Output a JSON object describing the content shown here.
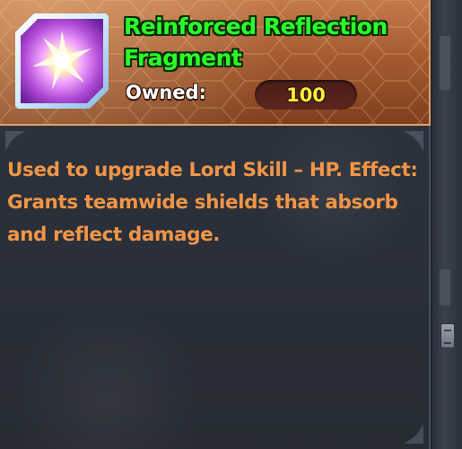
{
  "item": {
    "name": "Reinforced Reflection Fragment",
    "icon": "reflection-fragment-icon",
    "owned_label": "Owned:",
    "owned_count": "100",
    "description": "Used to upgrade Lord Skill – HP. Effect: Grants teamwide shields that absorb and reflect damage."
  },
  "colors": {
    "name": "#2bff2b",
    "description": "#f19547",
    "owned_value": "#f6f13a",
    "header": "#a65b31",
    "body": "#2a2f38"
  }
}
